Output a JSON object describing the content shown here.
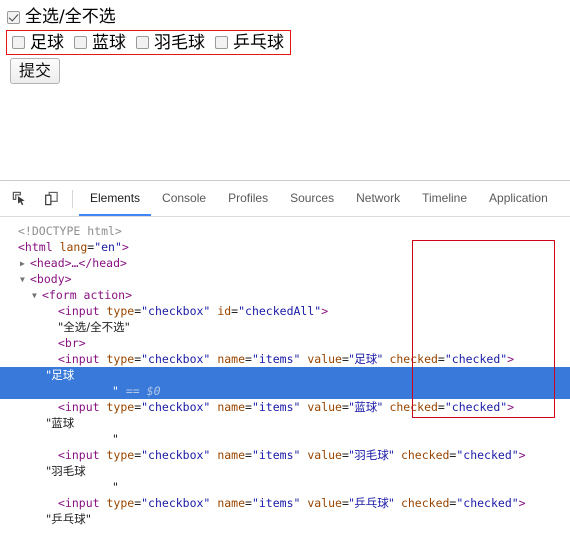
{
  "page": {
    "select_all": {
      "label": "全选/全不选",
      "checked": true
    },
    "items": [
      {
        "label": "足球",
        "checked": false
      },
      {
        "label": "蓝球",
        "checked": false
      },
      {
        "label": "羽毛球",
        "checked": false
      },
      {
        "label": "乒乓球",
        "checked": false
      }
    ],
    "submit_label": "提交"
  },
  "devtools": {
    "icons": {
      "inspect": "inspect-element-icon",
      "device": "device-toolbar-icon"
    },
    "tabs": [
      {
        "label": "Elements",
        "active": true
      },
      {
        "label": "Console",
        "active": false
      },
      {
        "label": "Profiles",
        "active": false
      },
      {
        "label": "Sources",
        "active": false
      },
      {
        "label": "Network",
        "active": false
      },
      {
        "label": "Timeline",
        "active": false
      },
      {
        "label": "Application",
        "active": false
      }
    ],
    "dom": {
      "doctype": "<!DOCTYPE html>",
      "html_open_tag": "<html",
      "html_attr_name": "lang",
      "html_attr_value": "\"en\"",
      "html_close_bracket": ">",
      "head_line": "<head>…</head>",
      "body_line": "<body>",
      "form_line": "<form action>",
      "input_all": {
        "open": "<input",
        "attr_type": "type",
        "val_type": "\"checkbox\"",
        "attr_id": "id",
        "val_id": "\"checkedAll\"",
        "close": ">"
      },
      "text_all": "\"全选/全不选\"",
      "br": "<br>",
      "inputs": [
        {
          "open": "<input",
          "attr_type": "type",
          "val_type": "\"checkbox\"",
          "attr_name": "name",
          "val_name": "\"items\"",
          "attr_value": "value",
          "val_value": "\"足球\"",
          "attr_checked": "checked",
          "val_checked": "\"checked\"",
          "close": ">",
          "text_node": "\"足球",
          "text_node_tail": "\"",
          "selected": true,
          "selected_marker": "== $0"
        },
        {
          "open": "<input",
          "attr_type": "type",
          "val_type": "\"checkbox\"",
          "attr_name": "name",
          "val_name": "\"items\"",
          "attr_value": "value",
          "val_value": "\"蓝球\"",
          "attr_checked": "checked",
          "val_checked": "\"checked\"",
          "close": ">",
          "text_node": "\"蓝球",
          "text_node_tail": "\"",
          "selected": false,
          "selected_marker": ""
        },
        {
          "open": "<input",
          "attr_type": "type",
          "val_type": "\"checkbox\"",
          "attr_name": "name",
          "val_name": "\"items\"",
          "attr_value": "value",
          "val_value": "\"羽毛球\"",
          "attr_checked": "checked",
          "val_checked": "\"checked\"",
          "close": ">",
          "text_node": "\"羽毛球",
          "text_node_tail": "\"",
          "selected": false,
          "selected_marker": ""
        },
        {
          "open": "<input",
          "attr_type": "type",
          "val_type": "\"checkbox\"",
          "attr_name": "name",
          "val_name": "\"items\"",
          "attr_value": "value",
          "val_value": "\"乒乓球\"",
          "attr_checked": "checked",
          "val_checked": "\"checked\"",
          "close": ">",
          "text_node": "\"乒乓球\"",
          "text_node_tail": "",
          "selected": false,
          "selected_marker": ""
        }
      ]
    }
  },
  "annotations": {
    "highlight_color": "#d0021b"
  }
}
